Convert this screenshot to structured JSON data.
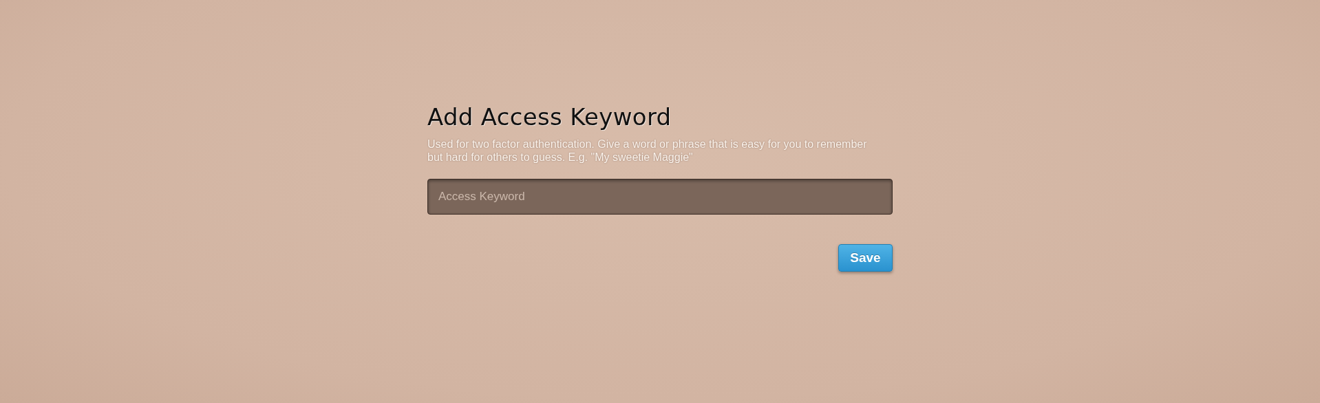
{
  "form": {
    "title": "Add Access Keyword",
    "description": "Used for two factor authentication. Give a word or phrase that is easy for you to remember but hard for others to guess. E.g. \"My sweetie Maggie\"",
    "keyword_field": {
      "placeholder": "Access Keyword"
    },
    "save_button": {
      "label": "Save"
    }
  }
}
